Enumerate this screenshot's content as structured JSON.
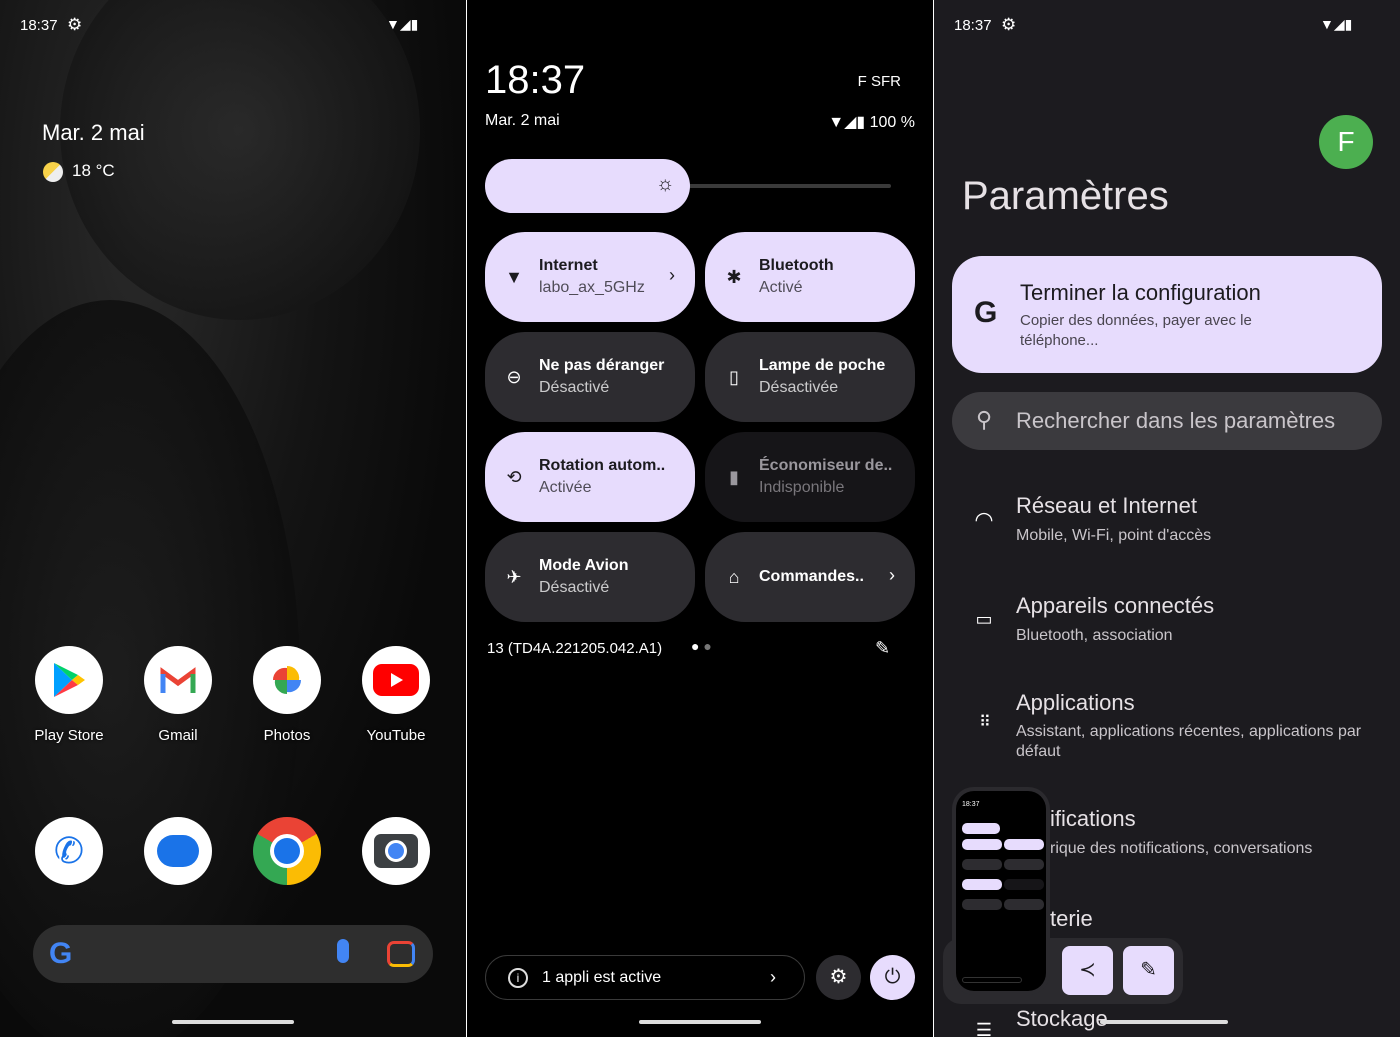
{
  "home": {
    "status_time": "18:37",
    "date": "Mar. 2 mai",
    "weather": "18 °C",
    "apps": [
      {
        "label": "Play Store",
        "icon": "play-store-icon"
      },
      {
        "label": "Gmail",
        "icon": "gmail-icon"
      },
      {
        "label": "Photos",
        "icon": "photos-icon"
      },
      {
        "label": "YouTube",
        "icon": "youtube-icon"
      }
    ],
    "dock": [
      {
        "icon": "phone-icon"
      },
      {
        "icon": "messages-icon"
      },
      {
        "icon": "chrome-icon"
      },
      {
        "icon": "camera-icon"
      }
    ]
  },
  "qs": {
    "time": "18:37",
    "carrier": "F SFR",
    "date": "Mar. 2 mai",
    "battery": "100 %",
    "brightness_percent": 50,
    "tiles": [
      {
        "title": "Internet",
        "subtitle": "labo_ax_5GHz",
        "state": "on",
        "icon": "wifi-icon"
      },
      {
        "title": "Bluetooth",
        "subtitle": "Activé",
        "state": "on",
        "icon": "bluetooth-icon"
      },
      {
        "title": "Ne pas déranger",
        "subtitle": "Désactivé",
        "state": "off",
        "icon": "do-not-disturb-icon"
      },
      {
        "title": "Lampe de poche",
        "subtitle": "Désactivée",
        "state": "off",
        "icon": "flashlight-icon"
      },
      {
        "title": "Rotation autom..",
        "subtitle": "Activée",
        "state": "on",
        "icon": "auto-rotate-icon"
      },
      {
        "title": "Économiseur de..",
        "subtitle": "Indisponible",
        "state": "disabled",
        "icon": "battery-saver-icon"
      },
      {
        "title": "Mode Avion",
        "subtitle": "Désactivé",
        "state": "off",
        "icon": "airplane-icon"
      },
      {
        "title": "Commandes..",
        "subtitle": "",
        "state": "off",
        "icon": "home-icon"
      }
    ],
    "build": "13 (TD4A.221205.042.A1)",
    "active_apps": "1 appli est active"
  },
  "settings": {
    "status_time": "18:37",
    "avatar": "F",
    "avatar_color": "#4caf50",
    "title": "Paramètres",
    "setup_card": {
      "title": "Terminer la configuration",
      "subtitle": "Copier des données, payer avec le téléphone..."
    },
    "search_placeholder": "Rechercher dans les paramètres",
    "items": [
      {
        "title": "Réseau et Internet",
        "subtitle": "Mobile, Wi-Fi, point d'accès"
      },
      {
        "title": "Appareils connectés",
        "subtitle": "Bluetooth, association"
      },
      {
        "title": "Applications",
        "subtitle": "Assistant, applications récentes, applications par défaut"
      },
      {
        "title": "ifications",
        "subtitle": "rique des notifications, conversations"
      },
      {
        "title": "terie",
        "subtitle": ""
      },
      {
        "title": "Stockage",
        "subtitle": ""
      }
    ]
  },
  "colors": {
    "accent": "#e7dcfd",
    "tile_off": "#2d2c30",
    "settings_bg": "#1c1b1f"
  }
}
